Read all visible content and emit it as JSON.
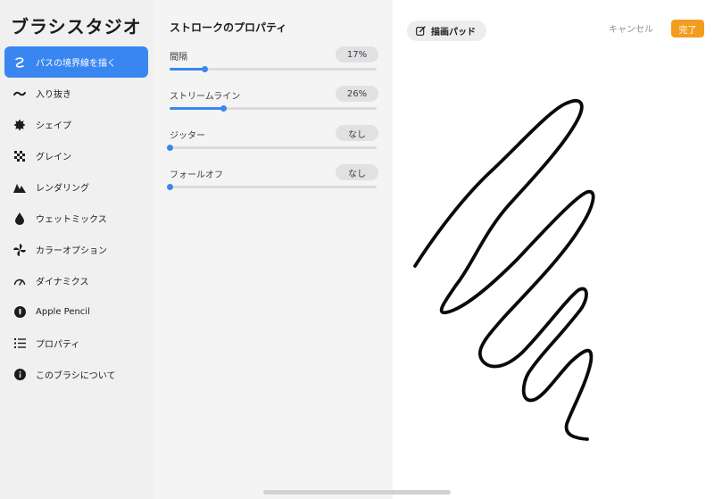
{
  "sidebar": {
    "title": "ブラシスタジオ",
    "items": [
      {
        "label": "パスの境界線を描く",
        "icon": "stroke-path-icon",
        "active": true
      },
      {
        "label": "入り抜き",
        "icon": "taper-icon",
        "active": false
      },
      {
        "label": "シェイプ",
        "icon": "shape-icon",
        "active": false
      },
      {
        "label": "グレイン",
        "icon": "grain-icon",
        "active": false
      },
      {
        "label": "レンダリング",
        "icon": "rendering-icon",
        "active": false
      },
      {
        "label": "ウェットミックス",
        "icon": "wet-mix-icon",
        "active": false
      },
      {
        "label": "カラーオプション",
        "icon": "color-options-icon",
        "active": false
      },
      {
        "label": "ダイナミクス",
        "icon": "dynamics-icon",
        "active": false
      },
      {
        "label": "Apple Pencil",
        "icon": "apple-pencil-icon",
        "active": false
      },
      {
        "label": "プロパティ",
        "icon": "properties-icon",
        "active": false
      },
      {
        "label": "このブラシについて",
        "icon": "about-icon",
        "active": false
      }
    ]
  },
  "panel": {
    "title": "ストロークのプロパティ",
    "settings": [
      {
        "label": "間隔",
        "value": "17%",
        "fraction": 0.17
      },
      {
        "label": "ストリームライン",
        "value": "26%",
        "fraction": 0.26
      },
      {
        "label": "ジッター",
        "value": "なし",
        "fraction": 0
      },
      {
        "label": "フォールオフ",
        "value": "なし",
        "fraction": 0
      }
    ]
  },
  "pad": {
    "label": "描画パッド",
    "cancel": "キャンセル",
    "done": "完了",
    "accent": "#3a86f0",
    "done_color": "#f39c1e"
  }
}
